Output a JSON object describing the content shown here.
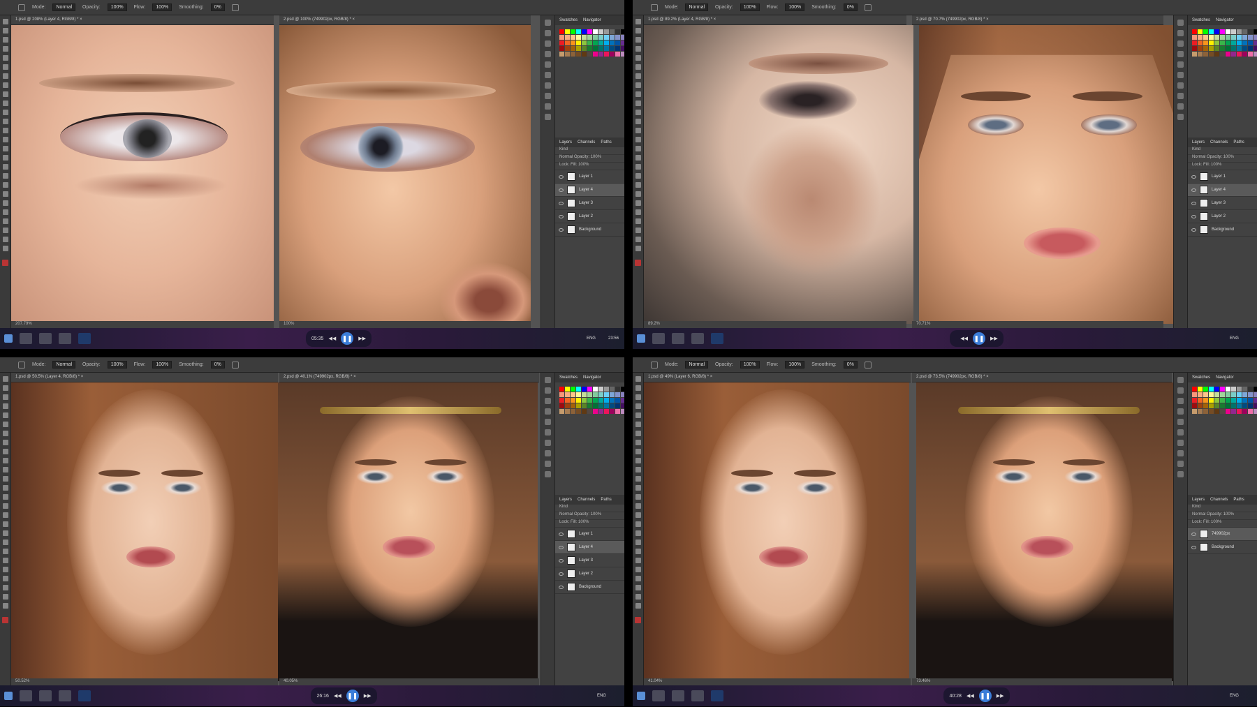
{
  "quadrants": [
    {
      "tab1": "1.psd @ 208% (Layer 4, RGB/8) *",
      "tab2": "2.psd @ 100% (749902px, RGB/8) *",
      "zoom1": "207.79%",
      "zoom2": "100%",
      "time": "05:35",
      "clock": "23:56",
      "layers": [
        "Layer 1",
        "Layer 4",
        "Layer 3",
        "Layer 2",
        "Background"
      ],
      "selected": 1
    },
    {
      "tab1": "1.psd @ 89.2% (Layer 4, RGB/8) *",
      "tab2": "2.psd @ 70.7% (749902px, RGB/8) *",
      "zoom1": "89.2%",
      "zoom2": "70.71%",
      "time": "",
      "clock": "",
      "layers": [
        "Layer 1",
        "Layer 4",
        "Layer 3",
        "Layer 2",
        "Background"
      ],
      "selected": 1
    },
    {
      "tab1": "1.psd @ 50.5% (Layer 4, RGB/8) *",
      "tab2": "2.psd @ 40.1% (749902px, RGB/8) *",
      "zoom1": "50.52%",
      "zoom2": "40.05%",
      "time": "26:16",
      "clock": "",
      "layers": [
        "Layer 1",
        "Layer 4",
        "Layer 3",
        "Layer 2",
        "Background"
      ],
      "selected": 1
    },
    {
      "tab1": "1.psd @ 49% (Layer 6, RGB/8) *",
      "tab2": "2.psd @ 73.5% (749902px, RGB/8) *",
      "zoom1": "41.04%",
      "zoom2": "73.46%",
      "time": "40:28",
      "clock": "",
      "layers": [
        "749902px",
        "Background"
      ],
      "selected": 0
    }
  ],
  "options": {
    "mode_label": "Mode:",
    "mode": "Normal",
    "opacity_label": "Opacity:",
    "opacity": "100%",
    "flow_label": "Flow:",
    "flow": "100%",
    "smoothing_label": "Smoothing:",
    "smoothing": "0%"
  },
  "panel": {
    "swatches": "Swatches",
    "navigator": "Navigator",
    "layers": "Layers",
    "channels": "Channels",
    "paths": "Paths",
    "kind": "Kind",
    "blend": "Normal",
    "opacity": "Opacity:",
    "opacity_val": "100%",
    "lock": "Lock:",
    "fill": "Fill:",
    "fill_val": "100%"
  },
  "taskbar": {
    "lang": "ENG"
  },
  "colors": {
    "ps_bg": "#535353",
    "panel": "#424242",
    "toolbar": "#3a3a3a",
    "accent": "#3b7dd8"
  }
}
